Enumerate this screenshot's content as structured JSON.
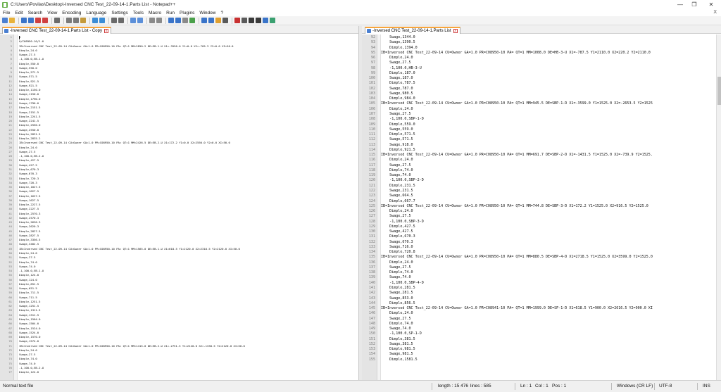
{
  "window": {
    "title": "C:\\Users\\Povilas\\Desktop\\-Inversed CNC Test_22-09-14-1.Parts List - Notepad++"
  },
  "menu": [
    "File",
    "Edit",
    "Search",
    "View",
    "Encoding",
    "Language",
    "Settings",
    "Tools",
    "Macro",
    "Run",
    "Plugins",
    "Window",
    "?"
  ],
  "menu_close": "X",
  "toolbar_icons": [
    "new-file-icon",
    "open-file-icon",
    "save-icon",
    "save-all-icon",
    "close-icon",
    "close-all-icon",
    "print-icon",
    "cut-icon",
    "copy-icon",
    "paste-icon",
    "undo-icon",
    "redo-icon",
    "find-icon",
    "replace-icon",
    "zoom-in-icon",
    "zoom-out-icon",
    "sync-v-icon",
    "sync-h-icon",
    "word-wrap-icon",
    "show-all-chars-icon",
    "indent-guide-icon",
    "udl-icon",
    "doc-map-icon",
    "function-list-icon",
    "folder-workspace-icon",
    "monitoring-icon",
    "record-macro-icon",
    "stop-macro-icon",
    "play-macro-icon",
    "run-macro-multiple-icon",
    "save-macro-icon",
    "spellcheck-icon"
  ],
  "left_pane": {
    "tab_label": "-Inversed CNC Test_22-09-14-1.Parts List - Copy",
    "tab_close": "x",
    "lines": [
      {
        "n": "1",
        "t": "1"
      },
      {
        "n": "2",
        "t": "H/C08950-10/1.0"
      },
      {
        "n": "3",
        "t": "IB=Inversed CNC Test_22-09-14 CU=Owner GA=1.0 PR=C08950-10 PA= QT=1 MM=2850.2 DE=EB-1-U X1=-3550.0 Y1=0.0 X2=-705.3 Y2=0.0 XI=50.0"
      },
      {
        "n": "4",
        "t": "Dimple,24.0"
      },
      {
        "n": "5",
        "t": "Swage,27.5"
      },
      {
        "n": "6",
        "t": "-1,100.0,EB-1-U"
      },
      {
        "n": "7",
        "t": "Dimple,550.0"
      },
      {
        "n": "8",
        "t": "Swage,550.0"
      },
      {
        "n": "9",
        "t": "Dimple,571.5"
      },
      {
        "n": "10",
        "t": "Swage,571.5"
      },
      {
        "n": "11",
        "t": "Dimple,921.5"
      },
      {
        "n": "12",
        "t": "Swage,921.5"
      },
      {
        "n": "13",
        "t": "Dimple,1150.0"
      },
      {
        "n": "14",
        "t": "Swage,1150.0"
      },
      {
        "n": "15",
        "t": "Dimple,1790.0"
      },
      {
        "n": "16",
        "t": "Swage,1790.0"
      },
      {
        "n": "17",
        "t": "Dimple,2151.5"
      },
      {
        "n": "18",
        "t": "Swage,2151.5"
      },
      {
        "n": "19",
        "t": "Dimple,2241.5"
      },
      {
        "n": "20",
        "t": "Swage,2241.5"
      },
      {
        "n": "21",
        "t": "Dimple,2550.0"
      },
      {
        "n": "22",
        "t": "Swage,2550.0"
      },
      {
        "n": "23",
        "t": "Dimple,2831.5"
      },
      {
        "n": "24",
        "t": "Dimple,2835.2"
      },
      {
        "n": "25",
        "t": "IB=Inversed CNC Test_22-09-14 CU=Owner GA=1.0 PR=C08950-10 PA= QT=1 MM=2426.5 DE=EB-2-U X1=172.2 Y1=0.0 X2=2550.0 Y2=0.0 XI=50.0"
      },
      {
        "n": "26",
        "t": "Dimple,24.0"
      },
      {
        "n": "27",
        "t": "Swage,27.5"
      },
      {
        "n": "28",
        "t": "-1,100.0,EB-2-U"
      },
      {
        "n": "29",
        "t": "Dimple,427.5"
      },
      {
        "n": "30",
        "t": "Swage,427.5"
      },
      {
        "n": "31",
        "t": "Dimple,670.3"
      },
      {
        "n": "32",
        "t": "Swage,670.3"
      },
      {
        "n": "33",
        "t": "Dimple,720.3"
      },
      {
        "n": "34",
        "t": "Swage,720.3"
      },
      {
        "n": "35",
        "t": "Dimple,1027.5"
      },
      {
        "n": "36",
        "t": "Swage,1027.5"
      },
      {
        "n": "37",
        "t": "Dimple,1627.5"
      },
      {
        "n": "38",
        "t": "Swage,1627.5"
      },
      {
        "n": "39",
        "t": "Dimple,2227.5"
      },
      {
        "n": "40",
        "t": "Swage,2227.5"
      },
      {
        "n": "41",
        "t": "Dimple,2570.3"
      },
      {
        "n": "42",
        "t": "Swage,2570.3"
      },
      {
        "n": "43",
        "t": "Dimple,2620.3"
      },
      {
        "n": "44",
        "t": "Swage,2620.3"
      },
      {
        "n": "45",
        "t": "Dimple,2827.5"
      },
      {
        "n": "46",
        "t": "Swage,2827.5"
      },
      {
        "n": "47",
        "t": "Dimple,3356.5"
      },
      {
        "n": "48",
        "t": "Swage,3402.5"
      },
      {
        "n": "49",
        "t": "IB=Inversed CNC Test_22-09-14 CU=Owner GA=1.0 PR=C08950-10 PA= QT=1 MM=1565.0 DE=EB-1-U X1=618.5 Y1=2120.0 X2=2318.5 Y2=2120.0 XI=50.0"
      },
      {
        "n": "50",
        "t": "Dimple,24.0"
      },
      {
        "n": "51",
        "t": "Swage,27.5"
      },
      {
        "n": "52",
        "t": "Dimple,74.0"
      },
      {
        "n": "53",
        "t": "Swage,74.0"
      },
      {
        "n": "54",
        "t": "-1,100.0,EB-1-U"
      },
      {
        "n": "55",
        "t": "Dimple,124.0"
      },
      {
        "n": "56",
        "t": "Swage,124.0"
      },
      {
        "n": "57",
        "t": "Dimple,651.5"
      },
      {
        "n": "58",
        "t": "Swage,651.5"
      },
      {
        "n": "59",
        "t": "Dimple,711.5"
      },
      {
        "n": "60",
        "t": "Swage,711.5"
      },
      {
        "n": "61",
        "t": "Dimple,1251.5"
      },
      {
        "n": "62",
        "t": "Swage,1251.5"
      },
      {
        "n": "63",
        "t": "Dimple,1311.5"
      },
      {
        "n": "64",
        "t": "Swage,1311.5"
      },
      {
        "n": "65",
        "t": "Dimple,1504.0"
      },
      {
        "n": "66",
        "t": "Swage,1504.0"
      },
      {
        "n": "67",
        "t": "Dimple,1524.0"
      },
      {
        "n": "68",
        "t": "Swage,1524.0"
      },
      {
        "n": "69",
        "t": "Dimple,1570.0"
      },
      {
        "n": "70",
        "t": "Swage,1574.0"
      },
      {
        "n": "71",
        "t": "IB=Inversed CNC Test_22-09-14 CU=Owner GA=1.0 PR=C08950-10 PA= QT=1 MM=1415.0 DE=EB-2-U X1=-2751.5 Y1=2120.0 X2=-1330.5 Y2=2120.0 XI=50.0"
      },
      {
        "n": "72",
        "t": "Dimple,24.0"
      },
      {
        "n": "73",
        "t": "Swage,27.5"
      },
      {
        "n": "74",
        "t": "Dimple,74.0"
      },
      {
        "n": "75",
        "t": "Swage,74.0"
      },
      {
        "n": "76",
        "t": "-1,100.0,EB-2-U"
      },
      {
        "n": "77",
        "t": "Dimple,124.0"
      }
    ]
  },
  "right_pane": {
    "tab_label": "-Inversed CNC Test_22-09-14-1.Parts List",
    "tab_close": "x",
    "lines": [
      {
        "n": "92",
        "t": "    Swage,1344.0"
      },
      {
        "n": "93",
        "t": "    Swage,1390.5"
      },
      {
        "n": "94",
        "t": "    Dimple,1394.0"
      },
      {
        "n": "95",
        "t": "IB=Inversed CNC Test_22-09-14 CU=Owner GA=1.0 PR=C08950-10 PA= QT=1 MM=1008.0 DE=HB-3-U X1=-787.5 Y1=2110.0 X2=220.2 Y2=2110.0"
      },
      {
        "n": "96",
        "t": "    Dimple,24.0"
      },
      {
        "n": "97",
        "t": "    Swage,27.5"
      },
      {
        "n": "98",
        "t": "    -1,100.0,HB-3-U"
      },
      {
        "n": "99",
        "t": "    Dimple,187.0"
      },
      {
        "n": "100",
        "t": "    Swage,187.0"
      },
      {
        "n": "101",
        "t": "    Dimple,787.5"
      },
      {
        "n": "102",
        "t": "    Swage,787.0"
      },
      {
        "n": "103",
        "t": "    Swage,980.5"
      },
      {
        "n": "104",
        "t": "    Dimple,984.0"
      },
      {
        "n": "105",
        "t": "IB=Inversed CNC Test_22-09-14 CU=Owner GA=1.0 PR=C08950-10 PA= QT=1 MM=945.5 DE=SBP-1-D X1=-3599.0 Y1=1525.0 X2=-2653.5 Y2=1525"
      },
      {
        "n": "106",
        "t": "    Dimple,24.0"
      },
      {
        "n": "107",
        "t": "    Swage,27.5"
      },
      {
        "n": "108",
        "t": "    -1,100.0,SBP-1-D"
      },
      {
        "n": "109",
        "t": "    Dimple,559.0"
      },
      {
        "n": "110",
        "t": "    Swage,559.0"
      },
      {
        "n": "111",
        "t": "    Dimple,571.5"
      },
      {
        "n": "112",
        "t": "    Swage,571.5"
      },
      {
        "n": "113",
        "t": "    Swage,918.0"
      },
      {
        "n": "114",
        "t": "    Dimple,921.5"
      },
      {
        "n": "115",
        "t": "IB=Inversed CNC Test_22-09-14 CU=Owner GA=1.0 PR=C08950-10 PA= QT=1 MM=691.7 DE=SBP-2-D X1=-1431.5 Y1=1525.0 X2=-739.9 Y2=1525."
      },
      {
        "n": "116",
        "t": "    Dimple,24.0"
      },
      {
        "n": "117",
        "t": "    Swage,27.5"
      },
      {
        "n": "118",
        "t": "    Dimple,74.0"
      },
      {
        "n": "119",
        "t": "    Swage,74.0"
      },
      {
        "n": "120",
        "t": "    -1,100.0,SBP-2-D"
      },
      {
        "n": "121",
        "t": "    Dimple,231.5"
      },
      {
        "n": "122",
        "t": "    Swage,231.5"
      },
      {
        "n": "123",
        "t": "    Swage,664.5"
      },
      {
        "n": "124",
        "t": "    Dimple,667.7"
      },
      {
        "n": "125",
        "t": "IB=Inversed CNC Test_22-09-14 CU=Owner GA=1.0 PR=C08950-10 PA= QT=1 MM=744.8 DE=SBP-3-D X1=172.2 Y1=1525.0 X2=916.5 Y2=1525.0"
      },
      {
        "n": "126",
        "t": "    Dimple,24.0"
      },
      {
        "n": "127",
        "t": "    Swage,27.5"
      },
      {
        "n": "128",
        "t": "    -1,100.0,SBP-3-D"
      },
      {
        "n": "129",
        "t": "    Dimple,427.5"
      },
      {
        "n": "130",
        "t": "    Swage,427.5"
      },
      {
        "n": "131",
        "t": "    Dimple,670.3"
      },
      {
        "n": "132",
        "t": "    Swage,670.3"
      },
      {
        "n": "133",
        "t": "    Swage,716.0"
      },
      {
        "n": "134",
        "t": "    Dimple,720.8"
      },
      {
        "n": "135",
        "t": "IB=Inversed CNC Test_22-09-14 CU=Owner GA=1.0 PR=C08950-10 PA= QT=1 MM=880.5 DE=SBP-4-D X1=2718.5 Y1=1525.0 X2=3599.0 Y2=1525.0"
      },
      {
        "n": "136",
        "t": "    Dimple,24.0"
      },
      {
        "n": "137",
        "t": "    Swage,27.5"
      },
      {
        "n": "138",
        "t": "    Dimple,74.0"
      },
      {
        "n": "139",
        "t": "    Swage,74.0"
      },
      {
        "n": "140",
        "t": "    -1,100.0,SBP-4-D"
      },
      {
        "n": "141",
        "t": "    Dimple,281.5"
      },
      {
        "n": "142",
        "t": "    Swage,281.5"
      },
      {
        "n": "143",
        "t": "    Swage,853.0"
      },
      {
        "n": "144",
        "t": "    Dimple,856.5"
      },
      {
        "n": "145",
        "t": "IB=Inversed CNC Test_22-09-14 CU=Owner GA=1.0 PR=C08941-10 PA= QT=1 MM=1999.0 DE=SP-1-D X1=618.5 Y1=900.0 X2=2616.5 Y2=900.0 XI"
      },
      {
        "n": "146",
        "t": "    Dimple,24.0"
      },
      {
        "n": "147",
        "t": "    Swage,27.5"
      },
      {
        "n": "148",
        "t": "    Dimple,74.0"
      },
      {
        "n": "149",
        "t": "    Swage,74.0"
      },
      {
        "n": "150",
        "t": "    -1,100.0,SP-1-D"
      },
      {
        "n": "151",
        "t": "    Dimple,381.5"
      },
      {
        "n": "152",
        "t": "    Swage,381.5"
      },
      {
        "n": "153",
        "t": "    Dimple,981.5"
      },
      {
        "n": "154",
        "t": "    Swage,981.5"
      },
      {
        "n": "155",
        "t": "    Dimple,1581.5"
      }
    ]
  },
  "status": {
    "file_type": "Normal text file",
    "length": "length : 15 476",
    "lines": "lines : 585",
    "ln": "Ln : 1",
    "col": "Col : 1",
    "pos": "Pos : 1",
    "eol": "Windows (CR LF)",
    "encoding": "UTF-8",
    "mode": "INS"
  },
  "colors": {
    "tab_accent": "#f9a53a",
    "gutter": "#e4e4e4",
    "app_icon": "#6ab04c"
  }
}
